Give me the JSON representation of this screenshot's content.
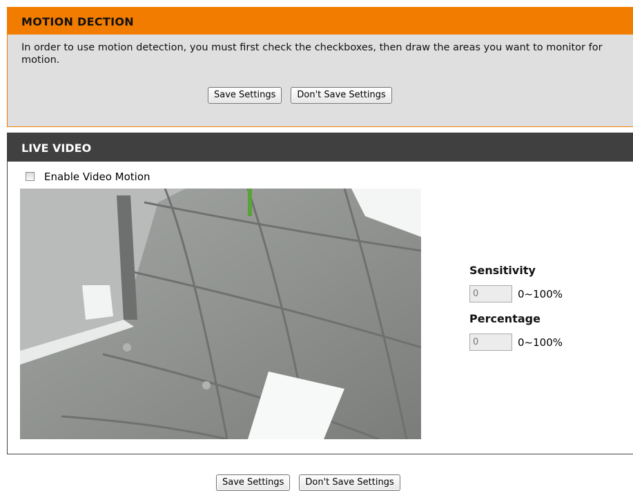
{
  "motion": {
    "title": "MOTION DECTION",
    "description": "In order to use motion detection, you must first check the checkboxes, then draw the areas you want to monitor for motion.",
    "save_label": "Save Settings",
    "dont_save_label": "Don't Save Settings"
  },
  "live_video": {
    "title": "LIVE VIDEO",
    "enable_label": "Enable Video Motion",
    "enable_checked": false
  },
  "settings": {
    "sensitivity_label": "Sensitivity",
    "sensitivity_value": "0",
    "sensitivity_range": "0~100%",
    "percentage_label": "Percentage",
    "percentage_value": "0",
    "percentage_range": "0~100%"
  },
  "footer": {
    "save_label": "Save Settings",
    "dont_save_label": "Don't Save Settings"
  }
}
